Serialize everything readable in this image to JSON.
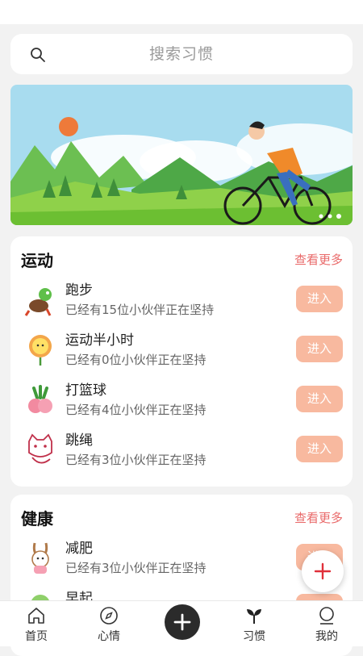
{
  "search": {
    "placeholder": "搜索习惯"
  },
  "sections": [
    {
      "title": "运动",
      "more_label": "查看更多",
      "items": [
        {
          "name": "跑步",
          "desc": "已经有15位小伙伴正在坚持",
          "button": "进入",
          "icon": "dinosaur-runner-icon"
        },
        {
          "name": "运动半小时",
          "desc": "已经有0位小伙伴正在坚持",
          "button": "进入",
          "icon": "sun-flower-icon"
        },
        {
          "name": "打篮球",
          "desc": "已经有4位小伙伴正在坚持",
          "button": "进入",
          "icon": "radish-icon"
        },
        {
          "name": "跳绳",
          "desc": "已经有3位小伙伴正在坚持",
          "button": "进入",
          "icon": "cat-icon"
        }
      ]
    },
    {
      "title": "健康",
      "more_label": "查看更多",
      "items": [
        {
          "name": "减肥",
          "desc": "已经有3位小伙伴正在坚持",
          "button": "进入",
          "icon": "bunny-icon"
        },
        {
          "name": "早起",
          "desc": "",
          "button": "进入",
          "icon": "tree-icon"
        }
      ]
    }
  ],
  "tabs": [
    {
      "label": "首页",
      "icon": "home-icon"
    },
    {
      "label": "心情",
      "icon": "compass-icon"
    },
    {
      "label": "",
      "icon": "plus-icon"
    },
    {
      "label": "习惯",
      "icon": "sprout-icon"
    },
    {
      "label": "我的",
      "icon": "user-icon"
    }
  ],
  "colors": {
    "accent": "#e96a6a",
    "button_bg": "#f8b99f",
    "background": "#f2f2f2"
  }
}
